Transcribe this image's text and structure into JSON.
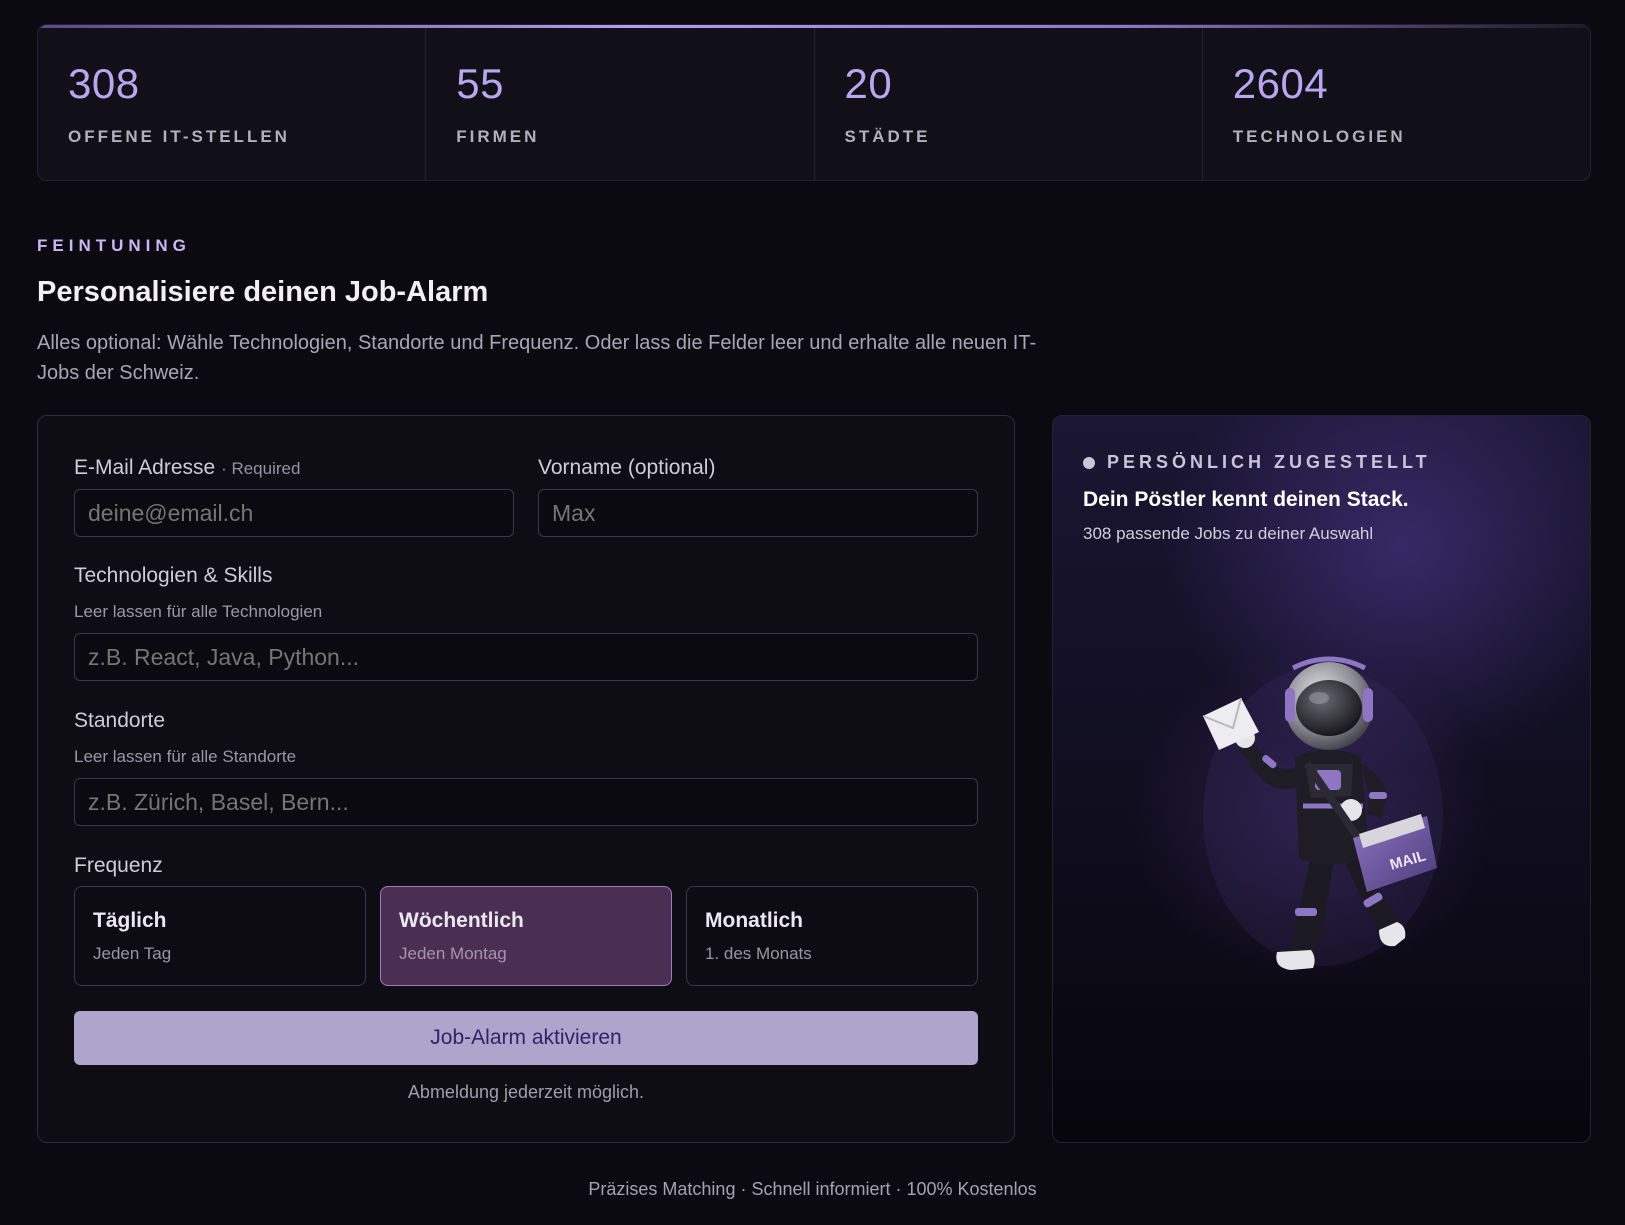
{
  "stats": [
    {
      "value": "308",
      "label": "OFFENE IT-STELLEN"
    },
    {
      "value": "55",
      "label": "FIRMEN"
    },
    {
      "value": "20",
      "label": "STÄDTE"
    },
    {
      "value": "2604",
      "label": "TECHNOLOGIEN"
    }
  ],
  "intro": {
    "eyebrow": "FEINTUNING",
    "title": "Personalisiere deinen Job-Alarm",
    "description": "Alles optional: Wähle Technologien, Standorte und Frequenz. Oder lass die Felder leer und erhalte alle neuen IT-Jobs der Schweiz."
  },
  "form": {
    "email_label": "E-Mail Adresse",
    "email_required": "· Required",
    "email_placeholder": "deine@email.ch",
    "firstname_label": "Vorname (optional)",
    "firstname_placeholder": "Max",
    "tech_label": "Technologien & Skills",
    "tech_hint": "Leer lassen für alle Technologien",
    "tech_placeholder": "z.B. React, Java, Python...",
    "location_label": "Standorte",
    "location_hint": "Leer lassen für alle Standorte",
    "location_placeholder": "z.B. Zürich, Basel, Bern...",
    "frequency_label": "Frequenz",
    "frequencies": [
      {
        "title": "Täglich",
        "sub": "Jeden Tag",
        "selected": false
      },
      {
        "title": "Wöchentlich",
        "sub": "Jeden Montag",
        "selected": true
      },
      {
        "title": "Monatlich",
        "sub": "1. des Monats",
        "selected": false
      }
    ],
    "submit_label": "Job-Alarm aktivieren",
    "footnote": "Abmeldung jederzeit möglich."
  },
  "promo": {
    "eyebrow": "PERSÖNLICH ZUGESTELLT",
    "title": "Dein Pöstler kennt deinen Stack.",
    "subtitle": "308 passende Jobs zu deiner Auswahl",
    "bag_text": "MAIL"
  },
  "footer": {
    "text": "Präzises Matching · Schnell informiert · 100% Kostenlos"
  }
}
